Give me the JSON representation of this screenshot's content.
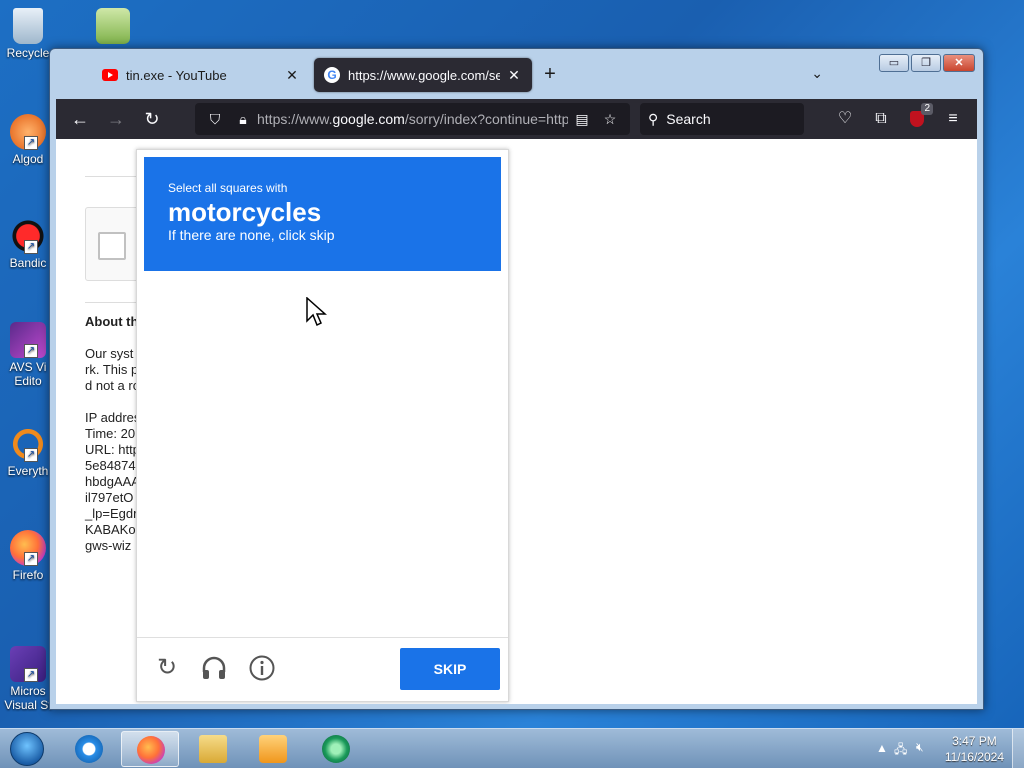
{
  "desktop": {
    "icons": [
      {
        "name": "recycle-bin",
        "label": "Recycle"
      },
      {
        "name": "notepad-plus",
        "label": ""
      },
      {
        "name": "algodoo",
        "label": "Algod"
      },
      {
        "name": "bandicam",
        "label": "Bandic"
      },
      {
        "name": "avs-video-editor",
        "label": "AVS Vi",
        "label2": "Edito"
      },
      {
        "name": "everything",
        "label": "Everyth"
      },
      {
        "name": "firefox",
        "label": "Firefo"
      },
      {
        "name": "visual-studio",
        "label": "Micros",
        "label2": "Visual St"
      }
    ]
  },
  "browser": {
    "tabs": [
      {
        "title": "tin.exe - YouTube",
        "favicon": "youtube-icon",
        "active": false
      },
      {
        "title": "https://www.google.com/searc",
        "favicon": "google-icon",
        "active": true
      }
    ],
    "new_tab": "+",
    "url_prefix": "https://www.",
    "url_domain": "google.com",
    "url_rest": "/sorry/index?continue=http",
    "search_placeholder": "Search",
    "extension_badge": "2",
    "window_controls": {
      "minimize": "▭",
      "maximize": "❐",
      "close": "✕"
    }
  },
  "page": {
    "about_heading": "About th",
    "text_lines": [
      "Our syst",
      "rk. This p",
      "d not a ro"
    ],
    "info_lines": [
      "IP addres",
      "Time: 20",
      "URL: http",
      "5e84874",
      "hbdgAAA",
      "il797etO",
      "_lp=Egdr",
      "KABAKo",
      "gws-wiz"
    ]
  },
  "captcha": {
    "instruction": "Select all squares with",
    "target": "motorcycles",
    "subtext": "If there are none, click skip",
    "skip_label": "SKIP"
  },
  "taskbar": {
    "time": "3:47 PM",
    "date": "11/16/2024"
  },
  "colors": {
    "captcha_blue": "#1a73e8",
    "browser_dark": "#2b2a33"
  }
}
